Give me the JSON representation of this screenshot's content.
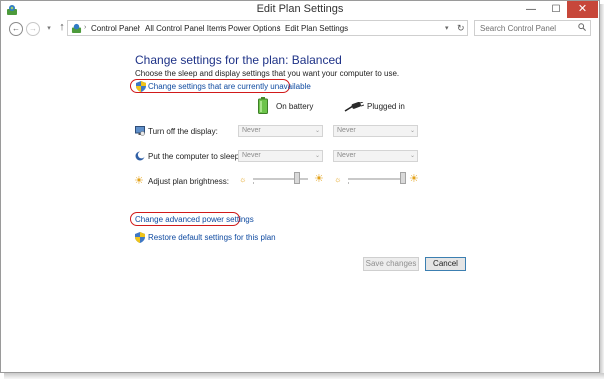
{
  "window": {
    "title": "Edit Plan Settings",
    "minimize_glyph": "—",
    "maximize_glyph": "☐",
    "close_glyph": "✕"
  },
  "address_bar": {
    "breadcrumbs": [
      "Control Panel",
      "All Control Panel Items",
      "Power Options",
      "Edit Plan Settings"
    ],
    "separator": "›",
    "search_placeholder": "Search Control Panel"
  },
  "page": {
    "heading": "Change settings for the plan: Balanced",
    "subtext": "Choose the sleep and display settings that you want your computer to use.",
    "unavailable_link": "Change settings that are currently unavailable",
    "columns": {
      "battery": "On battery",
      "plugged": "Plugged in"
    },
    "rows": [
      {
        "label": "Turn off the display:",
        "battery_value": "Never",
        "plugged_value": "Never"
      },
      {
        "label": "Put the computer to sleep:",
        "battery_value": "Never",
        "plugged_value": "Never"
      }
    ],
    "brightness": {
      "label": "Adjust plan brightness:",
      "battery_level": 0.8,
      "plugged_level": 1.0
    },
    "advanced_link": "Change advanced power settings",
    "restore_link": "Restore default settings for this plan"
  },
  "buttons": {
    "save": "Save changes",
    "cancel": "Cancel"
  },
  "colors": {
    "heading": "#1e3287",
    "link": "#0f4aa0",
    "highlight_ring": "#d11a1a",
    "close_button": "#c7473a"
  }
}
